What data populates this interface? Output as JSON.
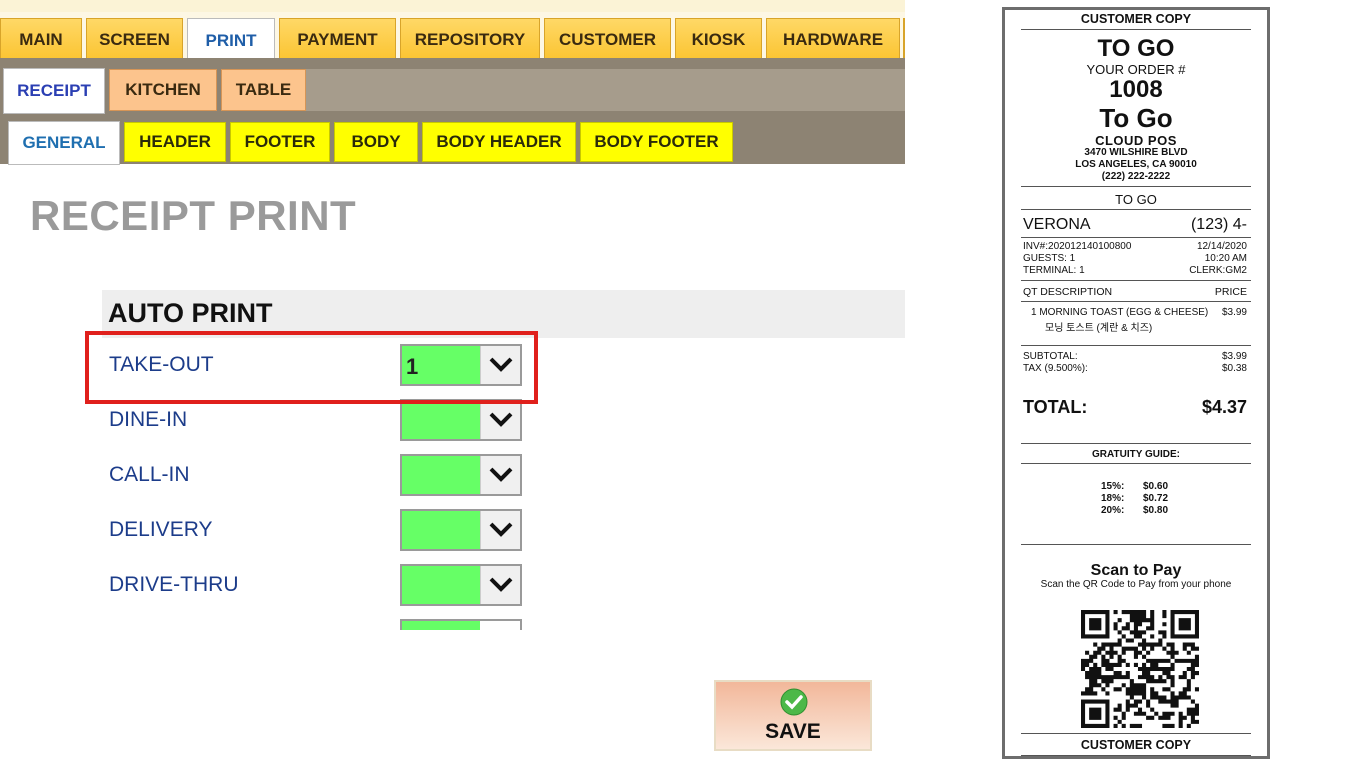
{
  "tabs_main": [
    {
      "label": "MAIN",
      "active": false
    },
    {
      "label": "SCREEN",
      "active": false
    },
    {
      "label": "PRINT",
      "active": true
    },
    {
      "label": "PAYMENT",
      "active": false
    },
    {
      "label": "REPOSITORY",
      "active": false
    },
    {
      "label": "CUSTOMER",
      "active": false
    },
    {
      "label": "KIOSK",
      "active": false
    },
    {
      "label": "HARDWARE",
      "active": false
    }
  ],
  "tabs_print": [
    {
      "label": "RECEIPT",
      "active": true
    },
    {
      "label": "KITCHEN",
      "active": false
    },
    {
      "label": "TABLE",
      "active": false
    }
  ],
  "tabs_receipt": [
    {
      "label": "GENERAL",
      "active": true
    },
    {
      "label": "HEADER",
      "active": false
    },
    {
      "label": "FOOTER",
      "active": false
    },
    {
      "label": "BODY",
      "active": false
    },
    {
      "label": "BODY HEADER",
      "active": false
    },
    {
      "label": "BODY FOOTER",
      "active": false
    }
  ],
  "page_title": "RECEIPT PRINT",
  "auto_print": {
    "title": "AUTO PRINT",
    "rows": [
      {
        "label": "TAKE-OUT",
        "value": "1"
      },
      {
        "label": "DINE-IN",
        "value": ""
      },
      {
        "label": "CALL-IN",
        "value": ""
      },
      {
        "label": "DELIVERY",
        "value": ""
      },
      {
        "label": "DRIVE-THRU",
        "value": ""
      }
    ]
  },
  "save_label": "SAVE",
  "colors": {
    "dropdown_fill": "#66ff66",
    "highlight": "#e0201c",
    "main_tab": "#fbc431",
    "print_tab": "#fcc48d",
    "receipt_tab": "#ffff00"
  },
  "receipt": {
    "copy_top": "CUSTOMER COPY",
    "order_type": "TO GO",
    "your_order": "YOUR ORDER #",
    "order_number": "1008",
    "order_type_big": "To Go",
    "store_name": "CLOUD POS",
    "address1": "3470 WILSHIRE BLVD",
    "address2": "LOS ANGELES, CA 90010",
    "phone": "(222) 222-2222",
    "to_go_line": "TO GO",
    "customer_name": "VERONA",
    "customer_phone": "(123) 4-",
    "inv": "INV#:202012140100800",
    "date": "12/14/2020",
    "guests": "GUESTS: 1",
    "time": "10:20 AM",
    "terminal": "TERMINAL: 1",
    "clerk": "CLERK:GM2",
    "col_qt_desc": "QT DESCRIPTION",
    "col_price": "PRICE",
    "item_line1": "1 MORNING TOAST (EGG & CHEESE)",
    "item_line2": "모닝 토스트 (계란 & 치즈)",
    "item_price": "$3.99",
    "subtotal_label": "SUBTOTAL:",
    "subtotal": "$3.99",
    "tax_label": "TAX (9.500%):",
    "tax": "$0.38",
    "total_label": "TOTAL:",
    "total": "$4.37",
    "gratuity_title": "GRATUITY GUIDE:",
    "gratuity": [
      {
        "pct": "15%:",
        "amt": "$0.60"
      },
      {
        "pct": "18%:",
        "amt": "$0.72"
      },
      {
        "pct": "20%:",
        "amt": "$0.80"
      }
    ],
    "scan_title": "Scan to Pay",
    "scan_sub": "Scan the QR Code to Pay from your phone",
    "copy_bottom": "CUSTOMER COPY"
  }
}
